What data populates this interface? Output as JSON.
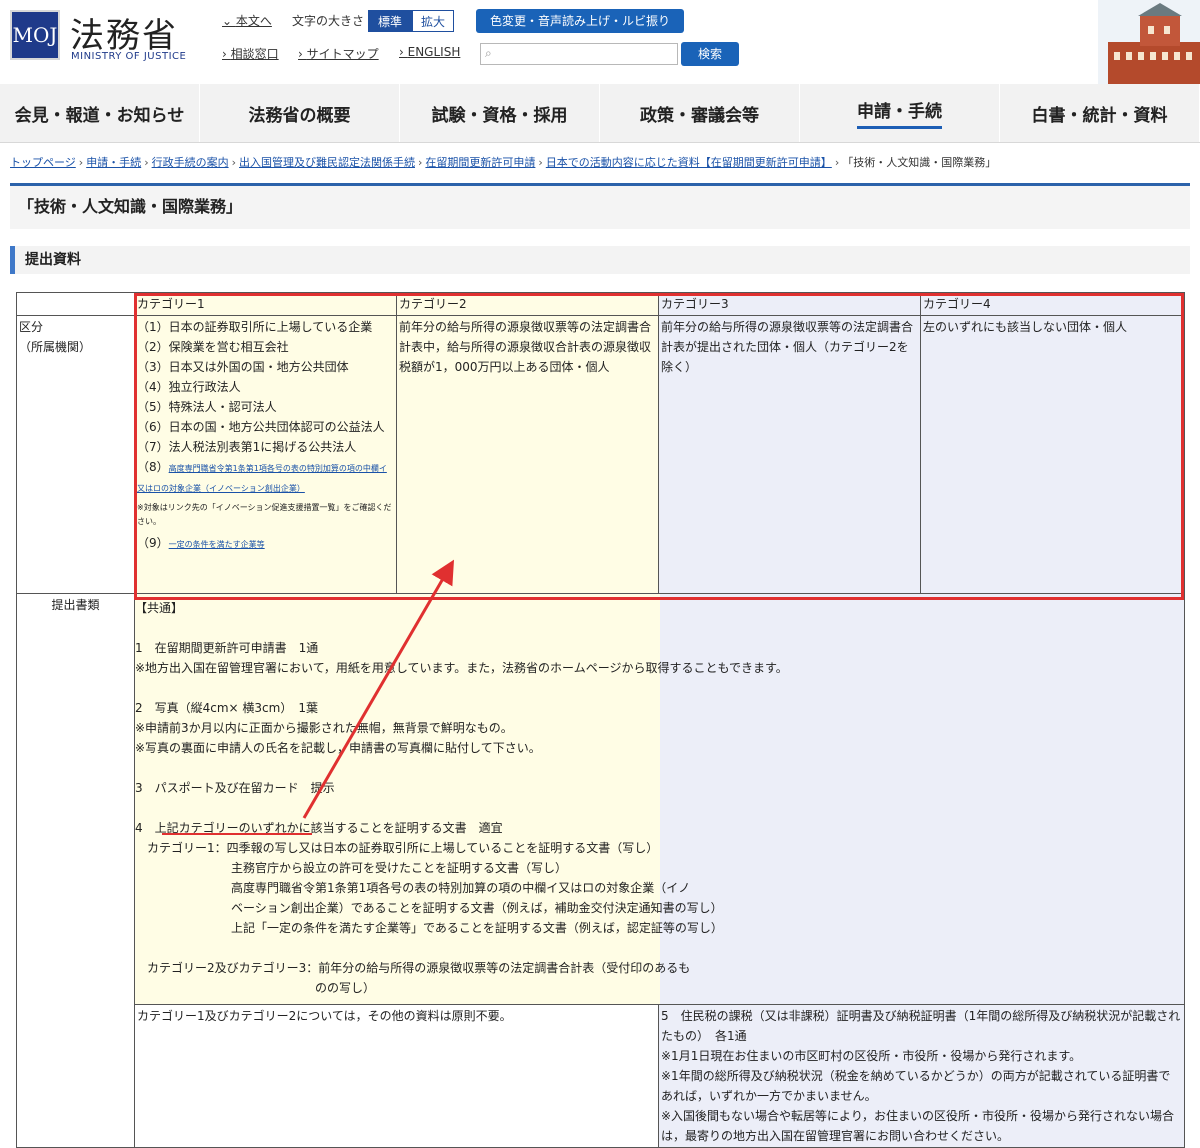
{
  "header": {
    "logo_text": "MOJ",
    "title": "法務省",
    "subtitle": "MINISTRY OF JUSTICE",
    "links": [
      "本文へ",
      "相談窓口",
      "サイトマップ",
      "ENGLISH"
    ],
    "font_size_label": "文字の大きさ",
    "font_standard": "標準",
    "font_large": "拡大",
    "accessibility_button": "色変更・音声読み上げ・ルビ振り",
    "search_placeholder": "",
    "search_button": "検索"
  },
  "nav": [
    "会見・報道・お知らせ",
    "法務省の概要",
    "試験・資格・採用",
    "政策・審議会等",
    "申請・手続",
    "白書・統計・資料"
  ],
  "breadcrumb": [
    "トップページ",
    "申請・手続",
    "行政手続の案内",
    "出入国管理及び難民認定法関係手続",
    "在留期間更新許可申請",
    "日本での活動内容に応じた資料【在留期間更新許可申請】",
    "「技術・人文知識・国際業務」"
  ],
  "page_title": "「技術・人文知識・国際業務」",
  "section_title": "提出資料",
  "table": {
    "headers": [
      "",
      "カテゴリー1",
      "カテゴリー2",
      "カテゴリー3",
      "カテゴリー4"
    ],
    "row1_label": "区分\n（所属機関）",
    "cat1_items": [
      "（1）日本の証券取引所に上場している企業",
      "（2）保険業を営む相互会社",
      "（3）日本又は外国の国・地方公共団体",
      "（4）独立行政法人",
      "（5）特殊法人・認可法人",
      "（6）日本の国・地方公共団体認可の公益法人",
      "（7）法人税法別表第1に掲げる公共法人"
    ],
    "cat1_item8_prefix": "（8）",
    "cat1_item8_link": "高度専門職省令第1条第1項各号の表の特別加算の項の中欄イ又はロの対象企業（イノベーション創出企業）",
    "cat1_note": "※対象はリンク先の「イノベーション促進支援措置一覧」をご確認ください。",
    "cat1_item9_prefix": "（9）",
    "cat1_item9_link": "一定の条件を満たす企業等",
    "cat2": "前年分の給与所得の源泉徴収票等の法定調書合計表中，給与所得の源泉徴収合計表の源泉徴収税額が1，000万円以上ある団体・個人",
    "cat3": "前年分の給与所得の源泉徴収票等の法定調書合計表が提出された団体・個人（カテゴリー2を除く）",
    "cat4": "左のいずれにも該当しない団体・個人",
    "docs_label": "提出書類",
    "docs_common": "【共通】\n\n1　在留期間更新許可申請書　1通\n※地方出入国在留管理官署において，用紙を用意しています。また，法務省のホームページから取得することもできます。\n\n2　写真（縦4cm× 横3cm）　1葉\n※申請前3か月以内に正面から撮影された無帽，無背景で鮮明なもの。\n※写真の裏面に申請人の氏名を記載し，申請書の写真欄に貼付して下さい。\n\n3　パスポート及び在留カード　提示\n\n4　上記カテゴリーのいずれかに該当することを証明する文書　適宜\n　カテゴリー1：四季報の写し又は日本の証券取引所に上場していることを証明する文書（写し）\n　　　　　　　　主務官庁から設立の許可を受けたことを証明する文書（写し）\n　　　　　　　　高度専門職省令第1条第1項各号の表の特別加算の項の中欄イ又はロの対象企業（イノ\n　　　　　　　　ベーション創出企業）であることを証明する文書（例えば，補助金交付決定通知書の写し）\n　　　　　　　　上記「一定の条件を満たす企業等」であることを証明する文書（例えば，認定証等の写し）\n\n　カテゴリー2及びカテゴリー3：前年分の給与所得の源泉徴収票等の法定調書合計表（受付印のあるも\n　　　　　　　　　　　　　　　のの写し）",
    "other_docs": "カテゴリー1及びカテゴリー2については，その他の資料は原則不要。",
    "doc5": "5　住民税の課税（又は非課税）証明書及び納税証明書（1年間の総所得及び納税状況が記載されたもの）　各1通\n※1月1日現在お住まいの市区町村の区役所・市役所・役場から発行されます。\n※1年間の総所得及び納税状況（税金を納めているかどうか）の両方が記載されている証明書であれば，いずれか一方でかまいません。\n※入国後間もない場合や転居等により，お住まいの区役所・市役所・役場から発行されない場合は，最寄りの地方出入国在留管理官署にお問い合わせください。"
  },
  "colors": {
    "category_12_bg": "#fffde5",
    "category_34_bg": "#eceef8",
    "highlight": "#e03030",
    "accent": "#1a63b8"
  }
}
